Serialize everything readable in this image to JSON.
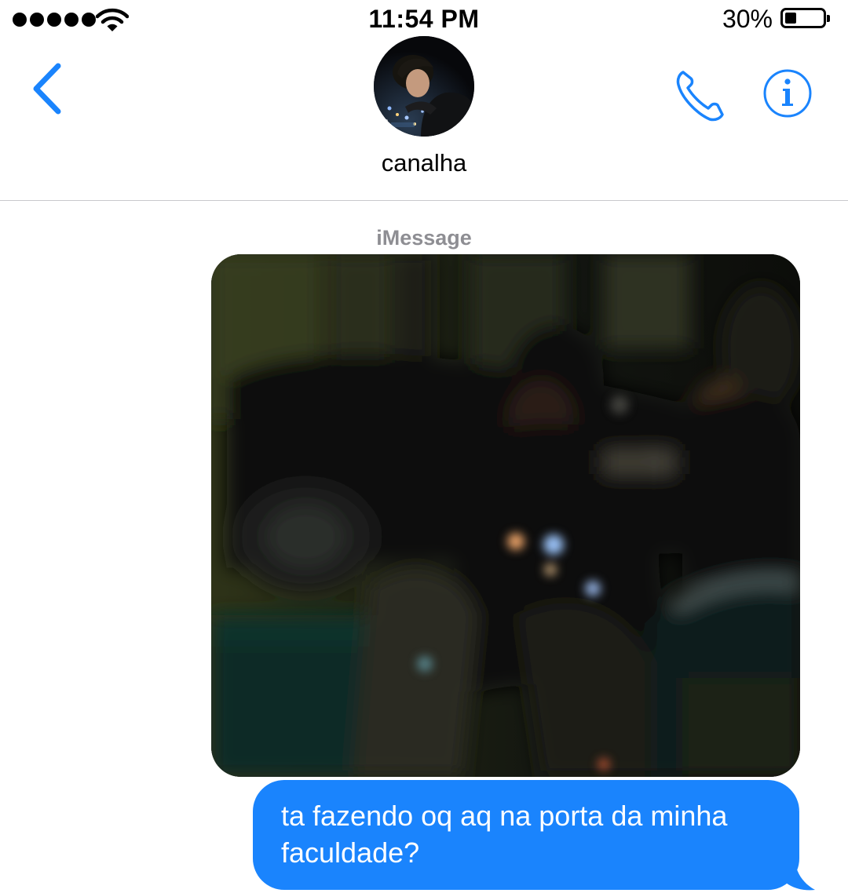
{
  "status_bar": {
    "signal_dots": 5,
    "wifi_icon": "wifi-icon",
    "time": "11:54 PM",
    "battery_percent": "30%",
    "battery_level": 0.3
  },
  "header": {
    "back_icon": "chevron-left-icon",
    "contact_name": "canalha",
    "call_icon": "phone-icon",
    "info_icon": "info-icon"
  },
  "conversation": {
    "service_label": "iMessage",
    "messages": [
      {
        "type": "photo",
        "direction": "outgoing"
      },
      {
        "type": "text",
        "direction": "outgoing",
        "text": "ta fazendo oq aq na porta da minha faculdade?"
      }
    ]
  },
  "colors": {
    "accent": "#1a84fd",
    "outgoing_bubble": "#1a84fd",
    "secondary_text": "#8e8e93",
    "divider": "#c8c8cc"
  }
}
